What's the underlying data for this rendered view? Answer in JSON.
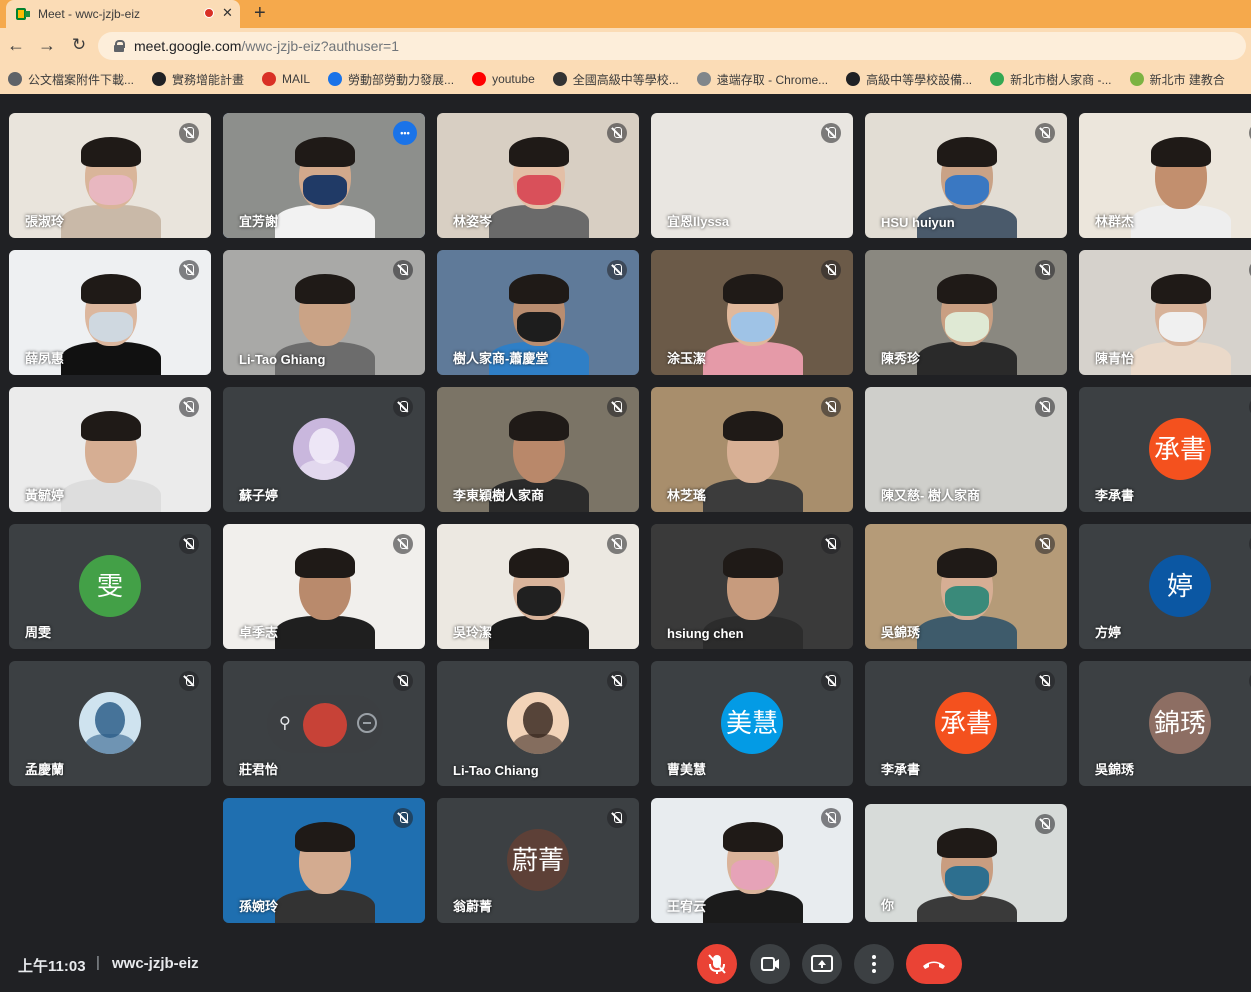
{
  "browser": {
    "tab_title": "Meet - wwc-jzjb-eiz",
    "url_host": "meet.google.com",
    "url_path": "/wwc-jzjb-eiz?authuser=1",
    "bookmarks": [
      {
        "label": "公文檔案附件下載...",
        "color": "#5f6368"
      },
      {
        "label": "實務增能計畫",
        "color": "#202124"
      },
      {
        "label": "MAIL",
        "color": "#d93025"
      },
      {
        "label": "勞動部勞動力發展...",
        "color": "#1a73e8"
      },
      {
        "label": "youtube",
        "color": "#ff0000"
      },
      {
        "label": "全國高級中等學校...",
        "color": "#333333"
      },
      {
        "label": "遠端存取 - Chrome...",
        "color": "#80868b"
      },
      {
        "label": "高級中等學校設備...",
        "color": "#202124"
      },
      {
        "label": "新北市樹人家商 -...",
        "color": "#34a853"
      },
      {
        "label": "新北市 建教合",
        "color": "#7cb342"
      }
    ]
  },
  "participants": [
    {
      "name": "張淑玲",
      "type": "video",
      "skin": "#d9b59a",
      "shirt": "#c9b9a8",
      "bg": "#e9e4dc",
      "mask": "#e8b7c0"
    },
    {
      "name": "宜芳謝",
      "type": "video",
      "skin": "#d2a98c",
      "shirt": "#f2f2f2",
      "bg": "#8d8f8c",
      "mask": "#203a66",
      "selected": true
    },
    {
      "name": "林姿岑",
      "type": "video",
      "skin": "#e3bfa6",
      "shirt": "#6a6a6a",
      "bg": "#d8cfc3",
      "mask": "#d9505a"
    },
    {
      "name": "宜恩Ilyssa",
      "type": "video",
      "skin": "#e8e4df",
      "shirt": "#e8e4df",
      "bg": "#e9e6e1",
      "mask": null,
      "empty": true
    },
    {
      "name": "HSU huiyun",
      "type": "video",
      "skin": "#c9a286",
      "shirt": "#4a5a6b",
      "bg": "#e2ddd4",
      "mask": "#3a78c2"
    },
    {
      "name": "林群杰",
      "type": "video",
      "skin": "#c28f6e",
      "shirt": "#eeeeee",
      "bg": "#ece6dc",
      "mask": null
    },
    {
      "name": "薛夙惠",
      "type": "video",
      "skin": "#dcb79e",
      "shirt": "#111111",
      "bg": "#eef0f2",
      "mask": "#cfd8e0"
    },
    {
      "name": "Li-Tao Ghiang",
      "type": "video",
      "skin": "#caa386",
      "shirt": "#6c6c6c",
      "bg": "#a9a9a7",
      "mask": null
    },
    {
      "name": "樹人家商-蕭慶堂",
      "type": "video",
      "skin": "#b98d70",
      "shirt": "#2f7fc6",
      "bg": "#5f7a99",
      "mask": "#1d1d1d"
    },
    {
      "name": "涂玉潔",
      "type": "video",
      "skin": "#e0b89b",
      "shirt": "#e59aa8",
      "bg": "#6b5a48",
      "mask": "#9fc3e6"
    },
    {
      "name": "陳秀珍",
      "type": "video",
      "skin": "#c99f82",
      "shirt": "#2a2a2a",
      "bg": "#8a8880",
      "mask": "#dfe9d4"
    },
    {
      "name": "陳青怡",
      "type": "video",
      "skin": "#d7b299",
      "shirt": "#ead9c9",
      "bg": "#d6d2cc",
      "mask": "#f0f0f0"
    },
    {
      "name": "黃毓婷",
      "type": "video",
      "skin": "#d6ae93",
      "shirt": "#dddddd",
      "bg": "#ebebeb",
      "mask": null
    },
    {
      "name": "蘇子婷",
      "type": "picture",
      "pic_bg": "#c9b7dd",
      "pic_fg": "#f3eefa"
    },
    {
      "name": "李東穎樹人家商",
      "type": "video",
      "skin": "#b9886a",
      "shirt": "#2b2b2b",
      "bg": "#7b7466",
      "mask": null
    },
    {
      "name": "林芝瑤",
      "type": "video",
      "skin": "#d8b095",
      "shirt": "#3c3c3c",
      "bg": "#a88e6c",
      "mask": null
    },
    {
      "name": "陳又慈- 樹人家商",
      "type": "video",
      "skin": "#d0d0cc",
      "shirt": "#d0d0cc",
      "bg": "#cfcfcb",
      "mask": null,
      "empty": true
    },
    {
      "name": "李承書",
      "type": "letter",
      "letter": "承書",
      "color": "#f4511e"
    },
    {
      "name": "周雯",
      "type": "letter",
      "letter": "雯",
      "color": "#43a047"
    },
    {
      "name": "卓季志",
      "type": "video",
      "skin": "#b98a6c",
      "shirt": "#1f1f1f",
      "bg": "#f1efec",
      "mask": null
    },
    {
      "name": "吳玲潔",
      "type": "video",
      "skin": "#d9b49b",
      "shirt": "#1c1c1c",
      "bg": "#ece8e1",
      "mask": "#202020"
    },
    {
      "name": "hsiung chen",
      "type": "video",
      "skin": "#c79b7d",
      "shirt": "#2c2c2c",
      "bg": "#3a3a3a",
      "mask": null
    },
    {
      "name": "吳錦琇",
      "type": "video",
      "skin": "#d6ae94",
      "shirt": "#3e5b6b",
      "bg": "#b59b78",
      "mask": "#3a8a7a"
    },
    {
      "name": "方婷",
      "type": "letter",
      "letter": "婷",
      "color": "#0b57a3"
    },
    {
      "name": "孟慶蘭",
      "type": "picture",
      "pic_bg": "#cfe3ef",
      "pic_fg": "#2e5f8a"
    },
    {
      "name": "莊君怡",
      "type": "hover"
    },
    {
      "name": "Li-Tao Chiang",
      "type": "picture",
      "pic_bg": "#f2d3b8",
      "pic_fg": "#3b2a22"
    },
    {
      "name": "曹美慧",
      "type": "letter",
      "letter": "美慧",
      "color": "#039be5"
    },
    {
      "name": "李承書",
      "type": "letter",
      "letter": "承書",
      "color": "#f4511e"
    },
    {
      "name": "吳錦琇",
      "type": "letter",
      "letter": "錦琇",
      "color": "#8d6e63"
    },
    {
      "name": "孫婉玲",
      "type": "video",
      "skin": "#d3ab90",
      "shirt": "#333333",
      "bg": "#1f6fb0",
      "mask": null
    },
    {
      "name": "翁蔚菁",
      "type": "letter",
      "letter": "蔚菁",
      "color": "#5d4037"
    },
    {
      "name": "王宥云",
      "type": "video",
      "skin": "#dab39a",
      "shirt": "#1b1b1b",
      "bg": "#e8ecef",
      "mask": "#e6a3b8"
    },
    {
      "name": "你",
      "type": "video",
      "skin": "#c99d80",
      "shirt": "#3a3a3a",
      "bg": "#d7dbd9",
      "mask": "#2d6f8f"
    }
  ],
  "bottom": {
    "time": "上午11:03",
    "separator": "|",
    "meeting_code": "wwc-jzjb-eiz"
  }
}
